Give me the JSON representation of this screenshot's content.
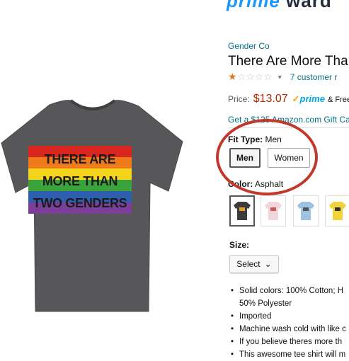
{
  "header": {
    "cut_text_a": "prime",
    "cut_text_b": "ward"
  },
  "product": {
    "brand": "Gender Co",
    "title": "There Are More Tha",
    "rating": {
      "stars": 1,
      "max": 5,
      "reviews": "7 customer r"
    },
    "price": {
      "label": "Price:",
      "value": "$13.07",
      "prime": "prime",
      "free": "& Free"
    },
    "gift": "Get a $125 Amazon.com Gift Ca",
    "shirt_print": [
      "THERE ARE",
      "MORE THAN",
      "TWO GENDERS"
    ],
    "fit": {
      "label": "Fit Type:",
      "value": "Men",
      "options": [
        "Men",
        "Women"
      ]
    },
    "color": {
      "label": "Color:",
      "value": "Asphalt",
      "swatches": [
        "#3c3c3c",
        "#f2d6d9",
        "#9cc3e4",
        "#f2d33d"
      ]
    },
    "size": {
      "label": "Size:",
      "select": "Select"
    },
    "bullets": [
      "Solid colors: 100% Cotton; H",
      "50% Polyester",
      "Imported",
      "Machine wash cold with like c",
      "If you believe theres more th",
      "This awesome tee shirt will m"
    ]
  },
  "colors": {
    "accent_link": "#007185",
    "price": "#b12704",
    "annotation_circle": "#c0392b",
    "prime": "#00a8e1"
  }
}
